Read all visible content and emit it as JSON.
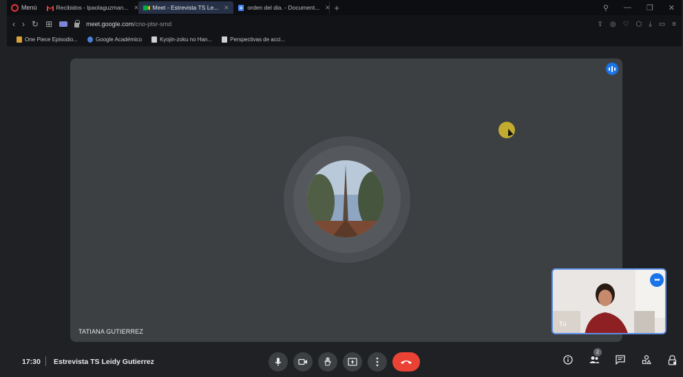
{
  "browser": {
    "menu_label": "Menú",
    "tabs": [
      {
        "label": "Recibidos - lpaolaguzman...",
        "icon": "gmail-icon"
      },
      {
        "label": "Meet - Estrevista TS Le...",
        "icon": "meet-icon",
        "active": true
      },
      {
        "label": "orden del dia. - Document...",
        "icon": "docs-icon"
      }
    ],
    "url_domain": "meet.google.com",
    "url_path": "/cno-ptsr-smd",
    "bookmarks": [
      {
        "label": "One Piece Episodio...",
        "icon": "animeflv-icon"
      },
      {
        "label": "Google Académico",
        "icon": "scholar-icon"
      },
      {
        "label": "Kyojin-zoku no Han...",
        "icon": "page-icon"
      },
      {
        "label": "Perspectivas de acci...",
        "icon": "page-icon"
      }
    ]
  },
  "meeting": {
    "participant_name": "TATIANA GUTIERREZ",
    "self_label": "Tú",
    "time": "17:30",
    "title": "Estrevista TS Leidy Gutierrez",
    "participants_count": "2"
  },
  "colors": {
    "accent_blue": "#1a73e8",
    "end_call_red": "#ea4335",
    "stage_bg": "#3c4043"
  }
}
